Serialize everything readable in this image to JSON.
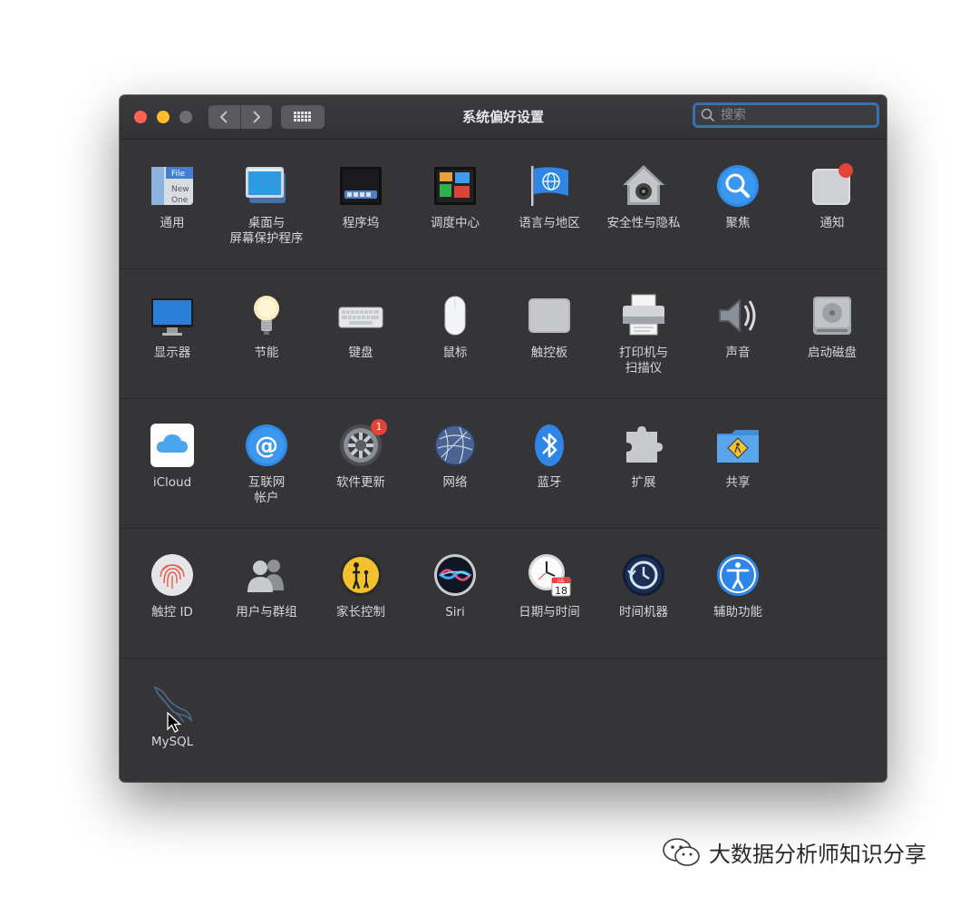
{
  "window": {
    "title": "系统偏好设置",
    "search": {
      "placeholder": "搜索",
      "value": ""
    }
  },
  "rows": [
    [
      {
        "label": "通用",
        "icon": "general-icon",
        "icon_text": [
          "File",
          "New",
          "One"
        ]
      },
      {
        "label": "桌面与\n屏幕保护程序",
        "icon": "desktop-screensaver-icon"
      },
      {
        "label": "程序坞",
        "icon": "dock-icon"
      },
      {
        "label": "调度中心",
        "icon": "mission-control-icon"
      },
      {
        "label": "语言与地区",
        "icon": "language-region-icon"
      },
      {
        "label": "安全性与隐私",
        "icon": "security-privacy-icon"
      },
      {
        "label": "聚焦",
        "icon": "spotlight-icon"
      },
      {
        "label": "通知",
        "icon": "notifications-icon"
      }
    ],
    [
      {
        "label": "显示器",
        "icon": "displays-icon"
      },
      {
        "label": "节能",
        "icon": "energy-saver-icon"
      },
      {
        "label": "键盘",
        "icon": "keyboard-icon"
      },
      {
        "label": "鼠标",
        "icon": "mouse-icon"
      },
      {
        "label": "触控板",
        "icon": "trackpad-icon"
      },
      {
        "label": "打印机与\n扫描仪",
        "icon": "printers-scanners-icon"
      },
      {
        "label": "声音",
        "icon": "sound-icon"
      },
      {
        "label": "启动磁盘",
        "icon": "startup-disk-icon"
      }
    ],
    [
      {
        "label": "iCloud",
        "icon": "icloud-icon"
      },
      {
        "label": "互联网\n帐户",
        "icon": "internet-accounts-icon"
      },
      {
        "label": "软件更新",
        "icon": "software-update-icon",
        "badge": "1"
      },
      {
        "label": "网络",
        "icon": "network-icon"
      },
      {
        "label": "蓝牙",
        "icon": "bluetooth-icon"
      },
      {
        "label": "扩展",
        "icon": "extensions-icon"
      },
      {
        "label": "共享",
        "icon": "sharing-icon"
      }
    ],
    [
      {
        "label": "触控 ID",
        "icon": "touch-id-icon"
      },
      {
        "label": "用户与群组",
        "icon": "users-groups-icon"
      },
      {
        "label": "家长控制",
        "icon": "parental-controls-icon"
      },
      {
        "label": "Siri",
        "icon": "siri-icon"
      },
      {
        "label": "日期与时间",
        "icon": "date-time-icon",
        "icon_text": [
          "JUL",
          "18"
        ]
      },
      {
        "label": "时间机器",
        "icon": "time-machine-icon"
      },
      {
        "label": "辅助功能",
        "icon": "accessibility-icon"
      }
    ],
    [
      {
        "label": "MySQL",
        "icon": "mysql-icon"
      }
    ]
  ],
  "watermark": "大数据分析师知识分享",
  "colors": {
    "accent": "#3b6fb4",
    "window_bg": "#353538",
    "badge": "#e5433a"
  }
}
